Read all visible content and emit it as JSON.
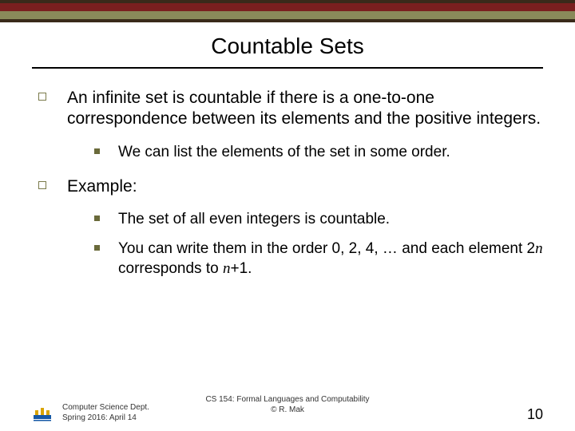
{
  "title": "Countable Sets",
  "bullets": [
    {
      "text": "An infinite set is countable if there is a one-to-one correspondence between its elements and the positive integers.",
      "sub": [
        {
          "text": "We can list the elements of the set in some order."
        }
      ]
    },
    {
      "text": "Example:",
      "sub": [
        {
          "text": "The set of all even integers is countable."
        },
        {
          "html": "You can write them in the order 0, 2, 4, … and each element 2<span class=\"mathvar\">n</span> corresponds to <span class=\"mathvar\">n</span>+1."
        }
      ]
    }
  ],
  "footer": {
    "dept_line1": "Computer Science Dept.",
    "dept_line2": "Spring 2016: April 14",
    "center_line1": "CS 154: Formal Languages and Computability",
    "center_line2": "© R. Mak",
    "page": "10"
  }
}
